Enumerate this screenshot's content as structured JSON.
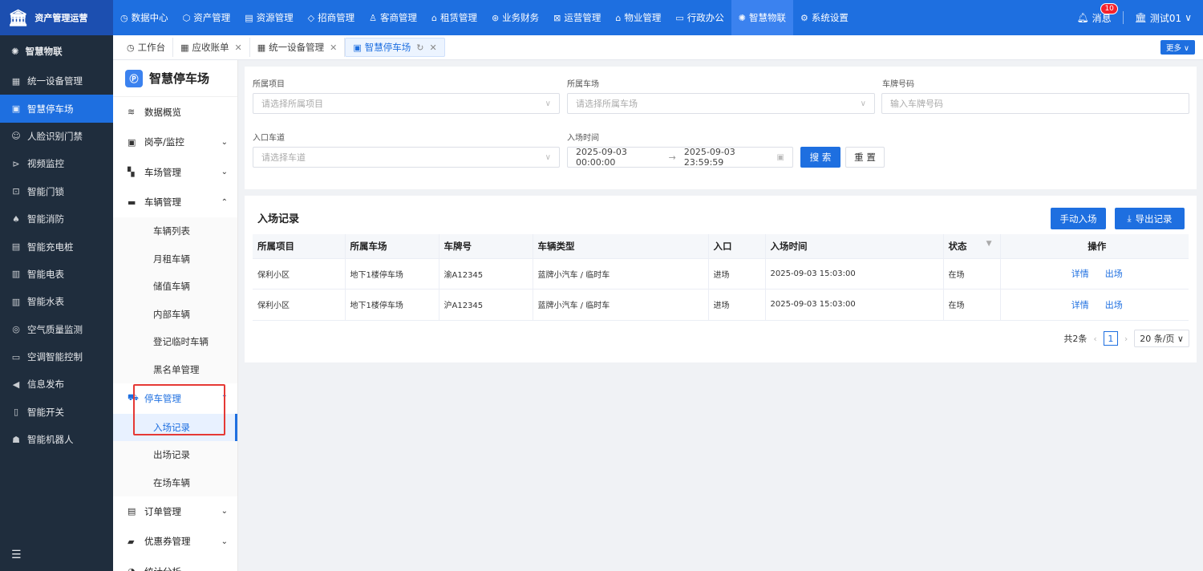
{
  "topbar": {
    "brand": "资产管理运营",
    "nav": [
      {
        "icon": "◷",
        "label": "数据中心"
      },
      {
        "icon": "⬡",
        "label": "资产管理"
      },
      {
        "icon": "▤",
        "label": "资源管理"
      },
      {
        "icon": "◇",
        "label": "招商管理"
      },
      {
        "icon": "♙",
        "label": "客商管理"
      },
      {
        "icon": "⌂",
        "label": "租赁管理"
      },
      {
        "icon": "⊛",
        "label": "业务财务"
      },
      {
        "icon": "⊠",
        "label": "运营管理"
      },
      {
        "icon": "⌂",
        "label": "物业管理"
      },
      {
        "icon": "▭",
        "label": "行政办公"
      },
      {
        "icon": "✺",
        "label": "智慧物联"
      },
      {
        "icon": "⚙",
        "label": "系统设置"
      }
    ],
    "active_nav": "智慧物联",
    "message_label": "消息",
    "message_count": "10",
    "user_label": "测试01"
  },
  "sidebar": {
    "header": "智慧物联",
    "items": [
      {
        "icon": "▦",
        "label": "统一设备管理"
      },
      {
        "icon": "▣",
        "label": "智慧停车场"
      },
      {
        "icon": "☺",
        "label": "人脸识别门禁"
      },
      {
        "icon": "⊳",
        "label": "视频监控"
      },
      {
        "icon": "⊡",
        "label": "智能门锁"
      },
      {
        "icon": "♠",
        "label": "智能消防"
      },
      {
        "icon": "▤",
        "label": "智能充电桩"
      },
      {
        "icon": "▥",
        "label": "智能电表"
      },
      {
        "icon": "▥",
        "label": "智能水表"
      },
      {
        "icon": "◎",
        "label": "空气质量监测"
      },
      {
        "icon": "▭",
        "label": "空调智能控制"
      },
      {
        "icon": "◀",
        "label": "信息发布"
      },
      {
        "icon": "▯",
        "label": "智能开关"
      },
      {
        "icon": "☗",
        "label": "智能机器人"
      }
    ],
    "active_item": "智慧停车场"
  },
  "tabs": {
    "items": [
      {
        "label": "工作台",
        "closable": false
      },
      {
        "label": "应收账单",
        "closable": true
      },
      {
        "label": "统一设备管理",
        "closable": true
      },
      {
        "label": "智慧停车场",
        "closable": true
      }
    ],
    "active": "智慧停车场",
    "more_label": "更多 ∨"
  },
  "submenu": {
    "title": "智慧停车场",
    "items": [
      {
        "label": "数据概览",
        "icon": "≋",
        "type": "top",
        "chevron": ""
      },
      {
        "label": "岗亭/监控",
        "icon": "▣",
        "type": "top",
        "chevron": "⌄"
      },
      {
        "label": "车场管理",
        "icon": "▚",
        "type": "top",
        "chevron": "⌄"
      },
      {
        "label": "车辆管理",
        "icon": "▬",
        "type": "top",
        "chevron": "⌃"
      },
      {
        "label": "车辆列表",
        "type": "sub"
      },
      {
        "label": "月租车辆",
        "type": "sub"
      },
      {
        "label": "储值车辆",
        "type": "sub"
      },
      {
        "label": "内部车辆",
        "type": "sub"
      },
      {
        "label": "登记临时车辆",
        "type": "sub"
      },
      {
        "label": "黑名单管理",
        "type": "sub"
      },
      {
        "label": "停车管理",
        "icon": "⛟",
        "type": "open",
        "chevron": "⌃"
      },
      {
        "label": "入场记录",
        "type": "sub-active"
      },
      {
        "label": "出场记录",
        "type": "sub"
      },
      {
        "label": "在场车辆",
        "type": "sub"
      },
      {
        "label": "订单管理",
        "icon": "▤",
        "type": "top",
        "chevron": "⌄"
      },
      {
        "label": "优惠券管理",
        "icon": "▰",
        "type": "top",
        "chevron": "⌄"
      },
      {
        "label": "统计分析",
        "icon": "◕",
        "type": "top",
        "chevron": "⌄"
      }
    ]
  },
  "filters": {
    "project_label": "所属项目",
    "project_placeholder": "请选择所属项目",
    "lot_label": "所属车场",
    "lot_placeholder": "请选择所属车场",
    "plate_label": "车牌号码",
    "plate_placeholder": "输入车牌号码",
    "lane_label": "入口车道",
    "lane_placeholder": "请选择车道",
    "time_label": "入场时间",
    "time_start": "2025-09-03 00:00:00",
    "time_sep": "→",
    "time_end": "2025-09-03 23:59:59",
    "search_label": "搜 索",
    "reset_label": "重 置"
  },
  "records": {
    "title": "入场记录",
    "manual_entry_label": "手动入场",
    "export_label": "导出记录",
    "columns": [
      "所属项目",
      "所属车场",
      "车牌号",
      "车辆类型",
      "入口",
      "入场时间",
      "状态",
      "操作"
    ],
    "rows": [
      {
        "project": "保利小区",
        "lot": "地下1楼停车场",
        "plate": "渝A12345",
        "type": "蓝牌小汽车 / 临时车",
        "gate": "进场",
        "time": "2025-09-03 15:03:00",
        "status": "在场",
        "detail": "详情",
        "exit": "出场"
      },
      {
        "project": "保利小区",
        "lot": "地下1楼停车场",
        "plate": "沪A12345",
        "type": "蓝牌小汽车 / 临时车",
        "gate": "进场",
        "time": "2025-09-03 15:03:00",
        "status": "在场",
        "detail": "详情",
        "exit": "出场"
      }
    ],
    "total_label": "共2条",
    "current_page": "1",
    "page_size": "20 条/页"
  }
}
